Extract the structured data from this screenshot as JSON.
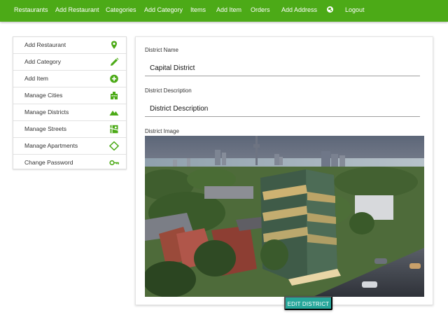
{
  "nav": {
    "items": [
      "Restaurants",
      "Add Restaurant",
      "Categories",
      "Add Category",
      "Items",
      "Add Item",
      "Orders",
      "Add Address"
    ],
    "language_icon": "globe-icon",
    "logout": "Logout",
    "bar_color": "#4caa17"
  },
  "sidebar": {
    "items": [
      {
        "label": "Add Restaurant",
        "icon": "map-marker-icon"
      },
      {
        "label": "Add Category",
        "icon": "pencil-icon"
      },
      {
        "label": "Add Item",
        "icon": "plus-circle-icon"
      },
      {
        "label": "Manage Cities",
        "icon": "building-icon"
      },
      {
        "label": "Manage Districts",
        "icon": "mountains-icon"
      },
      {
        "label": "Manage Streets",
        "icon": "map-icon"
      },
      {
        "label": "Manage Apartments",
        "icon": "diamond-icon"
      },
      {
        "label": "Change Password",
        "icon": "key-icon"
      }
    ],
    "icon_color": "#4caa17"
  },
  "form": {
    "name_label": "District Name",
    "name_value": "Capital District",
    "description_label": "District Description",
    "description_value": "District Description",
    "image_label": "District Image"
  },
  "actions": {
    "submit_label": "EDIT DISTRICT",
    "submit_color": "#26a69a"
  }
}
